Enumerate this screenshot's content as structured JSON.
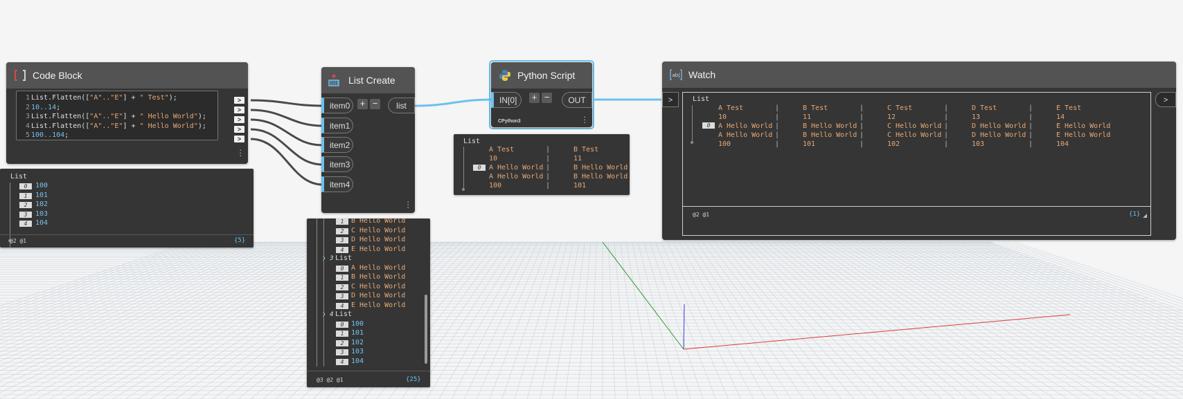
{
  "code_block": {
    "title": "Code Block",
    "lines": [
      {
        "num": "1",
        "parts": [
          {
            "t": "List.Flatten([",
            "c": "fn"
          },
          {
            "t": "\"A\"..\"E\"",
            "c": "str"
          },
          {
            "t": "] + ",
            "c": "fn"
          },
          {
            "t": "\" Test\"",
            "c": "str"
          },
          {
            "t": ");",
            "c": "fn"
          }
        ]
      },
      {
        "num": "2",
        "parts": [
          {
            "t": "10..14",
            "c": "num"
          },
          {
            "t": ";",
            "c": "fn"
          }
        ]
      },
      {
        "num": "3",
        "parts": [
          {
            "t": "List.Flatten([",
            "c": "fn"
          },
          {
            "t": "\"A\"..\"E\"",
            "c": "str"
          },
          {
            "t": "] + ",
            "c": "fn"
          },
          {
            "t": "\" Hello World\"",
            "c": "str"
          },
          {
            "t": ");",
            "c": "fn"
          }
        ]
      },
      {
        "num": "4",
        "parts": [
          {
            "t": "List.Flatten([",
            "c": "fn"
          },
          {
            "t": "\"A\"..\"E\"",
            "c": "str"
          },
          {
            "t": "] + ",
            "c": "fn"
          },
          {
            "t": "\" Hello World\"",
            "c": "str"
          },
          {
            "t": ");",
            "c": "fn"
          }
        ]
      },
      {
        "num": "5",
        "parts": [
          {
            "t": "100..104",
            "c": "num"
          },
          {
            "t": ";",
            "c": "fn"
          }
        ]
      }
    ],
    "preview": {
      "header": "List",
      "items": [
        {
          "idx": "0",
          "val": "100"
        },
        {
          "idx": "1",
          "val": "101"
        },
        {
          "idx": "2",
          "val": "102"
        },
        {
          "idx": "3",
          "val": "103"
        },
        {
          "idx": "4",
          "val": "104"
        }
      ],
      "footer_levels": "@2 @1",
      "count": "{5}"
    }
  },
  "list_create": {
    "title": "List Create",
    "inputs": [
      "item0",
      "item1",
      "item2",
      "item3",
      "item4"
    ],
    "add_label": "+",
    "remove_label": "−",
    "output": "list",
    "preview": {
      "partial_rows": [
        {
          "idx": "1",
          "val": "B Hello World"
        },
        {
          "idx": "2",
          "val": "C Hello World"
        },
        {
          "idx": "3",
          "val": "D Hello World"
        },
        {
          "idx": "4",
          "val": "E Hello World"
        }
      ],
      "group3": {
        "label": "3",
        "header": "List",
        "items": [
          {
            "idx": "0",
            "val": "A Hello World"
          },
          {
            "idx": "1",
            "val": "B Hello World"
          },
          {
            "idx": "2",
            "val": "C Hello World"
          },
          {
            "idx": "3",
            "val": "D Hello World"
          },
          {
            "idx": "4",
            "val": "E Hello World"
          }
        ]
      },
      "group4": {
        "label": "4",
        "header": "List",
        "items": [
          {
            "idx": "0",
            "val": "100"
          },
          {
            "idx": "1",
            "val": "101"
          },
          {
            "idx": "2",
            "val": "102"
          },
          {
            "idx": "3",
            "val": "103"
          },
          {
            "idx": "4",
            "val": "104"
          }
        ]
      },
      "footer_levels": "@3 @2 @1",
      "count": "{25}"
    }
  },
  "python_script": {
    "title": "Python Script",
    "input": "IN[0]",
    "add_label": "+",
    "remove_label": "−",
    "output": "OUT",
    "engine": "CPython3",
    "preview": {
      "header": "List",
      "index_label": "0",
      "col1": [
        "A Test",
        "10",
        "A Hello World",
        "A Hello World",
        "100"
      ],
      "col2": [
        "B Test",
        "11",
        "B Hello World",
        "B Hello World",
        "101"
      ]
    }
  },
  "watch": {
    "title": "Watch",
    "input_arrow": ">",
    "output_arrow": ">",
    "header": "List",
    "index_label": "0",
    "columns": [
      [
        "A Test",
        "10",
        "A Hello World",
        "A Hello World",
        "100"
      ],
      [
        "B Test",
        "11",
        "B Hello World",
        "B Hello World",
        "101"
      ],
      [
        "C Test",
        "12",
        "C Hello World",
        "C Hello World",
        "102"
      ],
      [
        "D Test",
        "13",
        "D Hello World",
        "D Hello World",
        "103"
      ],
      [
        "E Test",
        "14",
        "E Hello World",
        "E Hello World",
        "104"
      ]
    ],
    "footer_levels": "@2 @1",
    "count": "{1}"
  },
  "colors": {
    "canvas": "#f5f5f5",
    "node_body": "#353535",
    "node_header": "#535353",
    "selection": "#6ac1ef",
    "string_value": "#e8a975",
    "number_value": "#76c1ec",
    "grid_line": "#c9d3dc",
    "axis_x": "#e03a3a",
    "axis_y": "#2a9a2a",
    "axis_z": "#3a3ae0"
  },
  "icons": {
    "code_block": "brackets-icon",
    "list_create": "list-create-icon",
    "python_script": "python-icon",
    "watch": "watch-icon"
  }
}
